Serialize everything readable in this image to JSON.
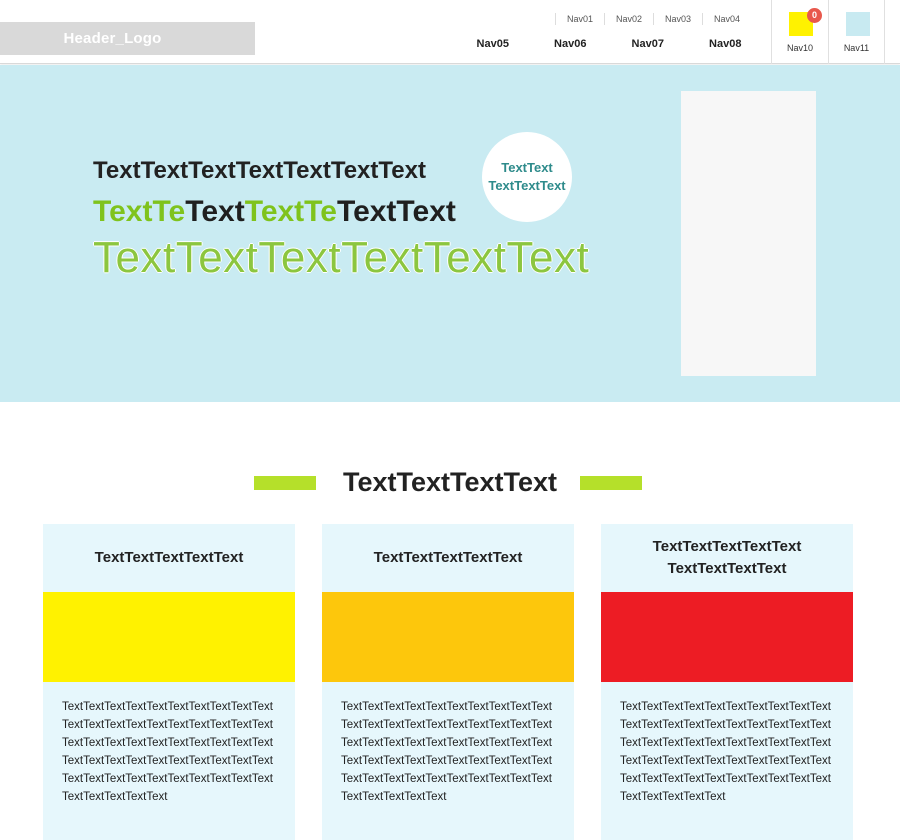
{
  "header": {
    "logo": "Header_Logo",
    "top_nav": [
      "Nav01",
      "Nav02",
      "Nav03",
      "Nav04"
    ],
    "main_nav": [
      "Nav05",
      "Nav06",
      "Nav07",
      "Nav08"
    ],
    "icons": [
      {
        "label": "Nav10",
        "badge": "0",
        "color": "#fff200",
        "icon": "yellow-square-icon"
      },
      {
        "label": "Nav11",
        "color": "#c8eaf1",
        "icon": "blue-square-icon"
      }
    ]
  },
  "hero": {
    "line1": "TextTextTextTextTextTextText",
    "line2": [
      {
        "text": "TextTe",
        "green": true
      },
      {
        "text": "Text",
        "green": false
      },
      {
        "text": "TextTe",
        "green": true
      },
      {
        "text": "TextText",
        "green": false
      }
    ],
    "line3": "TextTextTextTextTextText",
    "circle_line1": "TextText",
    "circle_line2": "TextTextText"
  },
  "section": {
    "title": "TextTextTextText",
    "cards": [
      {
        "title": "TextTextTextTextText",
        "image_color": "#fff200",
        "body": "TextTextTextTextTextTextTextTextTextTextTextTextTextTextTextTextTextTextTextTextTextTextTextTextTextTextTextTextTextTextTextTextTextTextTextTextTextTextTextTextTextTextTextTextTextTextTextTextTextTextTextTextTextTextText"
      },
      {
        "title": "TextTextTextTextText",
        "image_color": "#fdc70c",
        "body": "TextTextTextTextTextTextTextTextTextTextTextTextTextTextTextTextTextTextTextTextTextTextTextTextTextTextTextTextTextTextTextTextTextTextTextTextTextTextTextTextTextTextTextTextTextTextTextTextTextTextTextTextTextTextText"
      },
      {
        "title": "TextTextTextTextText TextTextTextText",
        "image_color": "#ed1c24",
        "body": "TextTextTextTextTextTextTextTextTextTextTextTextTextTextTextTextTextTextTextTextTextTextTextTextTextTextTextTextTextTextTextTextTextTextTextTextTextTextTextTextTextTextTextTextTextTextTextTextTextTextTextTextTextTextText"
      }
    ]
  }
}
